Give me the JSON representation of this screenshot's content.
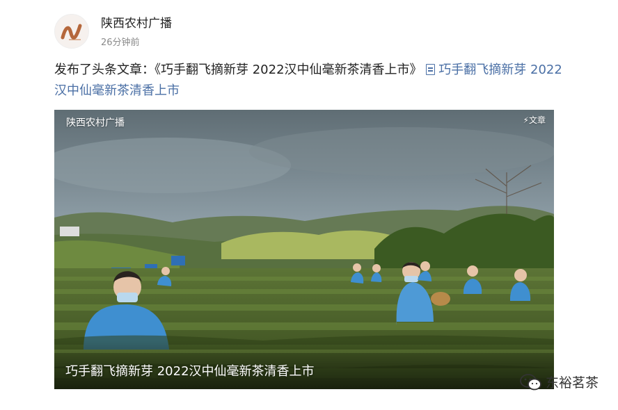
{
  "post": {
    "author": "陕西农村广播",
    "time": "26分钟前",
    "text_prefix": "发布了头条文章：《巧手翻飞摘新芽 2022汉中仙毫新茶清香上市》",
    "link_text": "巧手翻飞摘新芽 2022汉中仙毫新茶清香上市"
  },
  "card": {
    "source_label": "陕西农村广播",
    "badge": "文章",
    "caption": "巧手翻飞摘新芽 2022汉中仙毫新茶清香上市"
  },
  "watermark": {
    "text": "东裕茗茶"
  },
  "colors": {
    "link": "#4a6fa5",
    "uniform": "#3f8fd0",
    "tea": "#4f6a2e"
  }
}
